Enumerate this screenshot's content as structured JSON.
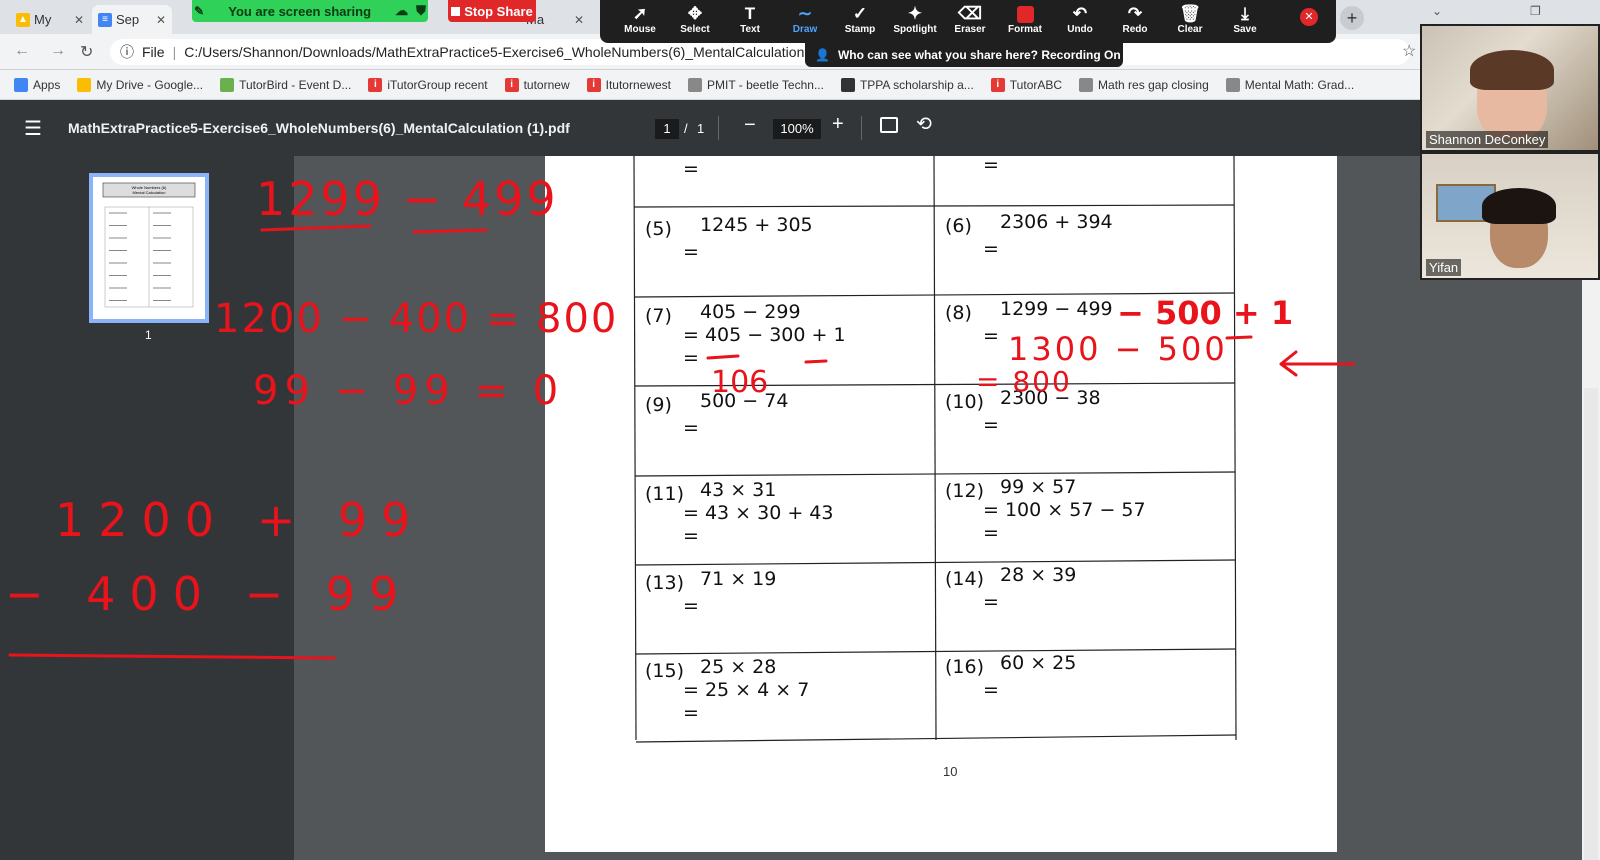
{
  "browser": {
    "tabs": [
      {
        "label": "My",
        "icon": "google-drive-icon"
      },
      {
        "label": "Sep",
        "icon": "docs-icon"
      },
      {
        "label": "Ma",
        "icon": "page-icon"
      }
    ],
    "address_label": "File",
    "url": "C:/Users/Shannon/Downloads/MathExtraPractice5-Exercise6_WholeNumbers(6)_MentalCalculation%2",
    "bookmarks": [
      {
        "label": "Apps",
        "icon": "apps-grid-icon",
        "color": "#4285f4"
      },
      {
        "label": "My Drive - Google...",
        "icon": "google-drive-icon",
        "color": "#fbbc04"
      },
      {
        "label": "TutorBird - Event D...",
        "icon": "tutorbird-icon",
        "color": "#6ab04c"
      },
      {
        "label": "iTutorGroup recent",
        "icon": "itutor-icon",
        "color": "#e53935"
      },
      {
        "label": "tutornew",
        "icon": "itutor-icon",
        "color": "#e53935"
      },
      {
        "label": "Itutornewest",
        "icon": "itutor-icon",
        "color": "#e53935"
      },
      {
        "label": "PMIT - beetle Techn...",
        "icon": "globe-icon",
        "color": "#888888"
      },
      {
        "label": "TPPA scholarship a...",
        "icon": "tppa-icon",
        "color": "#333333"
      },
      {
        "label": "TutorABC",
        "icon": "itutor-icon",
        "color": "#e53935"
      },
      {
        "label": "Math res gap closing",
        "icon": "globe-icon",
        "color": "#888888"
      },
      {
        "label": "Mental Math: Grad...",
        "icon": "globe-icon",
        "color": "#888888"
      }
    ]
  },
  "zoom": {
    "sharing_label": "You are screen sharing",
    "stop_share_label": "Stop Share",
    "toolbar": [
      {
        "label": "Mouse",
        "icon": "cursor-icon"
      },
      {
        "label": "Select",
        "icon": "move-icon"
      },
      {
        "label": "Text",
        "icon": "text-icon"
      },
      {
        "label": "Draw",
        "icon": "draw-icon"
      },
      {
        "label": "Stamp",
        "icon": "check-icon"
      },
      {
        "label": "Spotlight",
        "icon": "spotlight-icon"
      },
      {
        "label": "Eraser",
        "icon": "eraser-icon"
      },
      {
        "label": "Format",
        "icon": "format-icon"
      },
      {
        "label": "Undo",
        "icon": "undo-icon"
      },
      {
        "label": "Redo",
        "icon": "redo-icon"
      },
      {
        "label": "Clear",
        "icon": "trash-icon"
      },
      {
        "label": "Save",
        "icon": "download-icon"
      }
    ],
    "recording_banner": "Who can see what you share here? Recording On",
    "participants": [
      "Shannon DeConkey",
      "Yifan"
    ],
    "accent_color": "#e02828",
    "draw_color": "#4da3ff"
  },
  "pdf": {
    "title": "MathExtraPractice5-Exercise6_WholeNumbers(6)_MentalCalculation (1).pdf",
    "page_current": "1",
    "page_sep": "/",
    "page_total": "1",
    "zoom_level": "100%",
    "thumbnail_label": "1",
    "thumbnail_heading": "Whole Numbers (6)\nMental Calculation",
    "page_number": "10",
    "problems": [
      {
        "num": "(5)",
        "lines": [
          "1245 + 305",
          "="
        ]
      },
      {
        "num": "(6)",
        "lines": [
          "2306 + 394",
          "="
        ]
      },
      {
        "num": "(7)",
        "lines": [
          "405 − 299",
          "= 405 − 300 + 1",
          "="
        ]
      },
      {
        "num": "(8)",
        "lines": [
          "1299 − 499",
          "="
        ]
      },
      {
        "num": "(9)",
        "lines": [
          "500 − 74",
          "="
        ]
      },
      {
        "num": "(10)",
        "lines": [
          "2300 − 38",
          "="
        ]
      },
      {
        "num": "(11)",
        "lines": [
          "43 × 31",
          "= 43 × 30 + 43",
          "="
        ]
      },
      {
        "num": "(12)",
        "lines": [
          "99 × 57",
          "= 100 × 57 − 57",
          "="
        ]
      },
      {
        "num": "(13)",
        "lines": [
          "71 × 19",
          "="
        ]
      },
      {
        "num": "(14)",
        "lines": [
          "28 × 39",
          "="
        ]
      },
      {
        "num": "(15)",
        "lines": [
          "25 × 28",
          "= 25 × 4 × 7",
          "="
        ]
      },
      {
        "num": "(16)",
        "lines": [
          "60 × 25",
          "="
        ]
      }
    ]
  },
  "annotations": {
    "color": "#e8131b",
    "left_1": "1299 − 499",
    "left_2": "1200 − 400 = 800",
    "left_3": "99 − 99 = 0",
    "left_4": "1200 + 99",
    "left_5": "− 400 − 99",
    "page_7": "106",
    "page_8a": "− 500 + 1",
    "page_8b": "1300 − 500",
    "page_8c": "= 800"
  }
}
